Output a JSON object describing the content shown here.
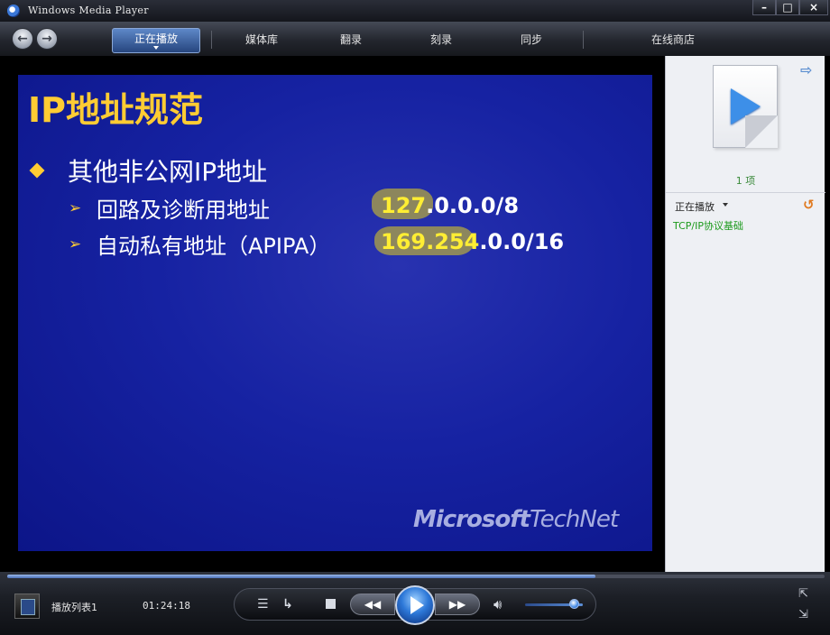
{
  "window": {
    "title": "Windows Media Player"
  },
  "titlebar_buttons": {
    "minimize": "–",
    "maximize": "□",
    "close": "×"
  },
  "nav": {
    "back_icon": "back-arrow-icon",
    "forward_icon": "forward-arrow-icon",
    "tabs": [
      {
        "label": "正在播放",
        "active": true
      },
      {
        "label": "媒体库"
      },
      {
        "label": "翻录"
      },
      {
        "label": "刻录"
      },
      {
        "label": "同步"
      },
      {
        "label": "在线商店"
      }
    ]
  },
  "slide": {
    "title": "IP地址规范",
    "bullet": "其他非公网IP地址",
    "sub_items": [
      {
        "label": "回路及诊断用地址",
        "ip_highlight": "127",
        "ip_rest": ".0.0.0/8"
      },
      {
        "label": "自动私有地址（APIPA）",
        "ip_highlight": "169.254",
        "ip_rest": ".0.0/16"
      }
    ],
    "watermark_a": "Microsoft",
    "watermark_b": "TechNet",
    "accent_color": "#ffcc33",
    "background_color": "#1622a2"
  },
  "playlist_panel": {
    "item_count": "1 项",
    "now_playing_label": "正在播放",
    "items": [
      "TCP/IP协议基础"
    ]
  },
  "controls": {
    "playlist_name": "播放列表1",
    "time": "01:24:18",
    "seek_progress": 0.72,
    "volume_level": 0.85
  }
}
